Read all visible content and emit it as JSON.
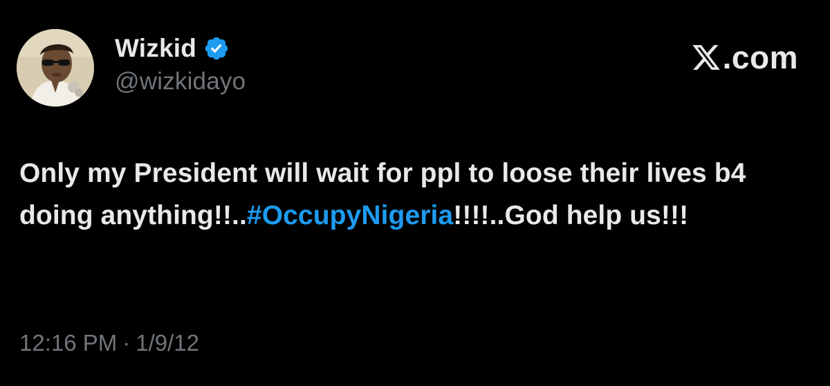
{
  "author": {
    "display_name": "Wizkid",
    "handle": "@wizkidayo",
    "verified": true,
    "verified_color": "#1d9bf0",
    "avatar_icon": "profile-photo"
  },
  "brand": {
    "logo_icon": "x-logo-icon",
    "suffix": ".com"
  },
  "tweet": {
    "text_before": "Only my President will wait for ppl to loose their lives b4 doing anything!!..",
    "hashtag": "#OccupyNigeria",
    "text_after": "!!!!..God help us!!!",
    "hashtag_color": "#1d9bf0"
  },
  "meta": {
    "time": "12:16 PM",
    "separator": "·",
    "date": "1/9/12"
  },
  "colors": {
    "background": "#000000",
    "primary_text": "#e7e9ea",
    "secondary_text": "#71767b"
  }
}
